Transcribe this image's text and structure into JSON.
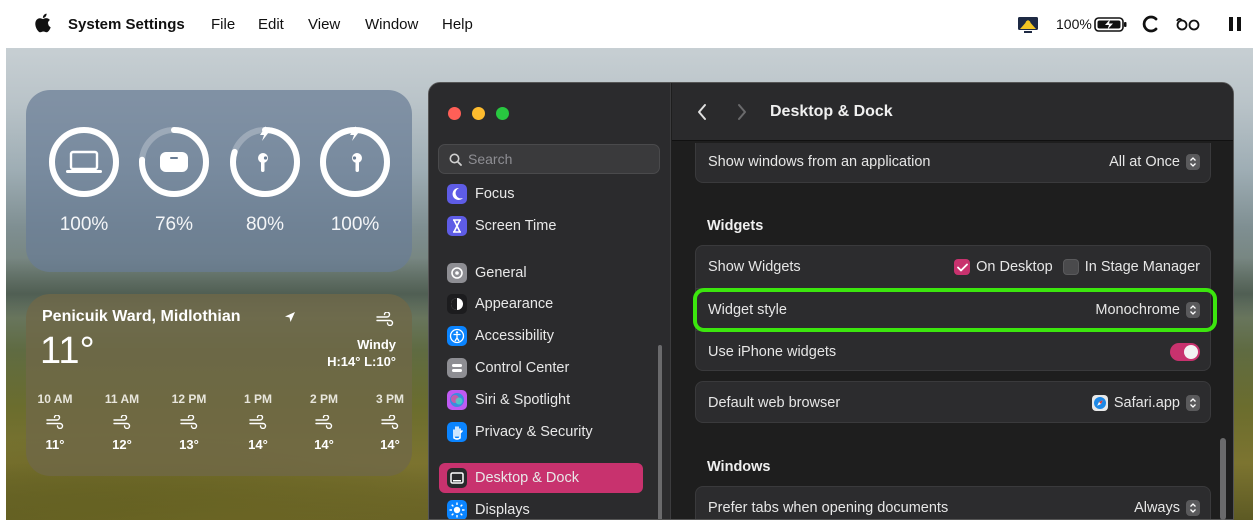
{
  "menubar": {
    "app_name": "System Settings",
    "menus": [
      "File",
      "Edit",
      "View",
      "Window",
      "Help"
    ],
    "battery_percent": "100%"
  },
  "battery_widget": {
    "devices": [
      {
        "icon": "laptop-icon",
        "label": "100%",
        "level": 1.0,
        "charging": false
      },
      {
        "icon": "airpods-case-icon",
        "label": "76%",
        "level": 0.76,
        "charging": false
      },
      {
        "icon": "airpod-left-icon",
        "label": "80%",
        "level": 0.8,
        "charging": true
      },
      {
        "icon": "airpod-right-icon",
        "label": "100%",
        "level": 1.0,
        "charging": true
      }
    ]
  },
  "weather_widget": {
    "location": "Penicuik Ward, Midlothian",
    "temperature": "11°",
    "condition": "Windy",
    "high_low": "H:14° L:10°",
    "hourly": [
      {
        "time": "10 AM",
        "temp": "11°"
      },
      {
        "time": "11 AM",
        "temp": "12°"
      },
      {
        "time": "12 PM",
        "temp": "13°"
      },
      {
        "time": "1 PM",
        "temp": "14°"
      },
      {
        "time": "2 PM",
        "temp": "14°"
      },
      {
        "time": "3 PM",
        "temp": "14°"
      }
    ]
  },
  "settings": {
    "search_placeholder": "Search",
    "sidebar": [
      {
        "label": "Focus",
        "icon": "focus-moon-icon",
        "color": "#5e5ce6"
      },
      {
        "label": "Screen Time",
        "icon": "hourglass-icon",
        "color": "#5e5ce6"
      },
      {
        "label": "General",
        "icon": "gear-icon",
        "color": "#8e8e93"
      },
      {
        "label": "Appearance",
        "icon": "appearance-icon",
        "color": "#1c1c1e"
      },
      {
        "label": "Accessibility",
        "icon": "accessibility-icon",
        "color": "#0a84ff"
      },
      {
        "label": "Control Center",
        "icon": "control-center-icon",
        "color": "#8e8e93"
      },
      {
        "label": "Siri & Spotlight",
        "icon": "siri-icon",
        "color": "#bf5af2"
      },
      {
        "label": "Privacy & Security",
        "icon": "hand-icon",
        "color": "#0a84ff"
      },
      {
        "label": "Desktop & Dock",
        "icon": "desktop-dock-icon",
        "color": "#1c1c1e",
        "selected": true
      },
      {
        "label": "Displays",
        "icon": "displays-icon",
        "color": "#0a84ff"
      }
    ],
    "pane_title": "Desktop & Dock",
    "show_windows": {
      "label": "Show windows from an application",
      "value": "All at Once"
    },
    "widgets_section": "Widgets",
    "show_widgets": {
      "label": "Show Widgets",
      "on_desktop": "On Desktop",
      "in_stage_manager": "In Stage Manager",
      "on_desktop_checked": true,
      "stage_manager_checked": false
    },
    "widget_style": {
      "label": "Widget style",
      "value": "Monochrome"
    },
    "iphone_widgets": {
      "label": "Use iPhone widgets",
      "enabled": true
    },
    "default_browser": {
      "label": "Default web browser",
      "value": "Safari.app"
    },
    "windows_section": "Windows",
    "prefer_tabs": {
      "label": "Prefer tabs when opening documents",
      "value": "Always"
    },
    "accent_color": "#c8326e",
    "highlight_color": "#3ce60e"
  }
}
